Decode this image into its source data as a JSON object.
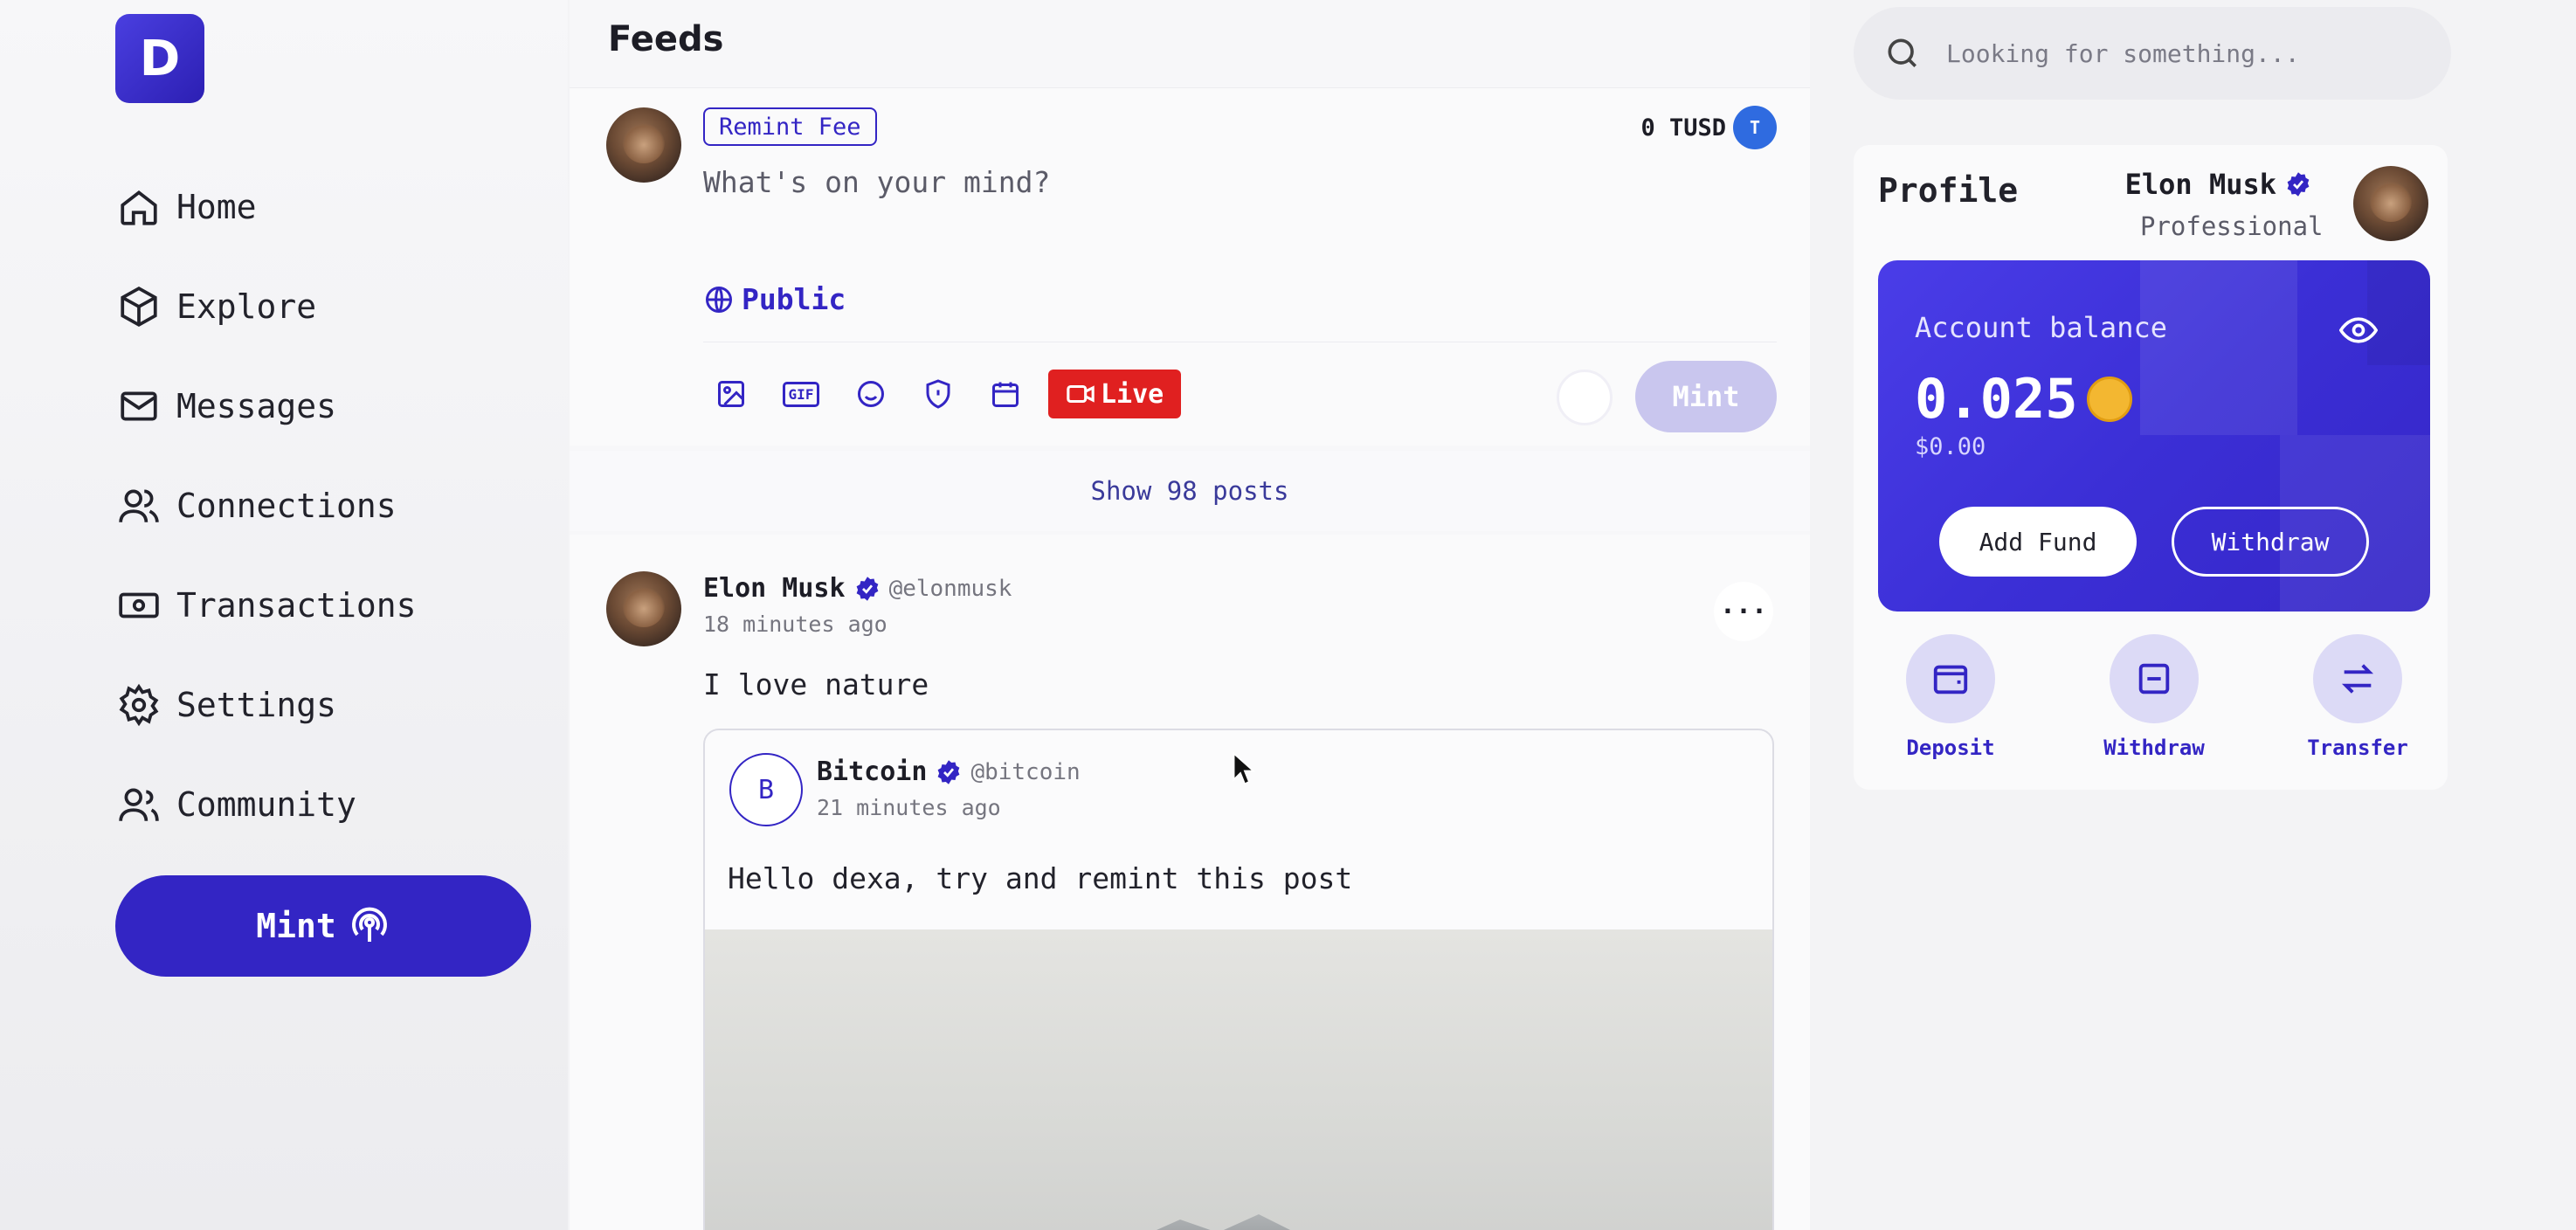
{
  "logo": {
    "letter": "D"
  },
  "nav": {
    "items": [
      {
        "label": "Home",
        "icon": "home-icon"
      },
      {
        "label": "Explore",
        "icon": "cube-icon"
      },
      {
        "label": "Messages",
        "icon": "mail-icon"
      },
      {
        "label": "Connections",
        "icon": "users-icon"
      },
      {
        "label": "Transactions",
        "icon": "cash-icon"
      },
      {
        "label": "Settings",
        "icon": "gear-icon"
      },
      {
        "label": "Community",
        "icon": "community-icon"
      }
    ],
    "mint_label": "Mint"
  },
  "feed": {
    "title": "Feeds",
    "composer": {
      "fee_tag": "Remint Fee",
      "balance": "0 TUSD",
      "placeholder": "What's on your mind?",
      "visibility": "Public",
      "gif_label": "GIF",
      "live_label": "Live",
      "mint_label": "Mint"
    },
    "show_posts": "Show 98 posts",
    "post": {
      "author": "Elon Musk",
      "handle": "@elonmusk",
      "time": "18 minutes ago",
      "text": "I love nature",
      "more": "···",
      "quote": {
        "avatar_letter": "B",
        "author": "Bitcoin",
        "handle": "@bitcoin",
        "time": "21 minutes ago",
        "text": "Hello dexa, try and remint this post"
      }
    }
  },
  "search": {
    "placeholder": "Looking for something..."
  },
  "profile": {
    "label": "Profile",
    "name": "Elon Musk",
    "role": "Professional",
    "balance_label": "Account balance",
    "balance_value": "0.025",
    "balance_usd": "$0.00",
    "add_fund": "Add Fund",
    "withdraw": "Withdraw",
    "actions": [
      {
        "label": "Deposit",
        "icon": "wallet-icon"
      },
      {
        "label": "Withdraw",
        "icon": "minus-square-icon"
      },
      {
        "label": "Transfer",
        "icon": "transfer-icon"
      }
    ]
  },
  "colors": {
    "accent": "#3325c4",
    "live": "#e02020",
    "coin": "#f3b731"
  }
}
